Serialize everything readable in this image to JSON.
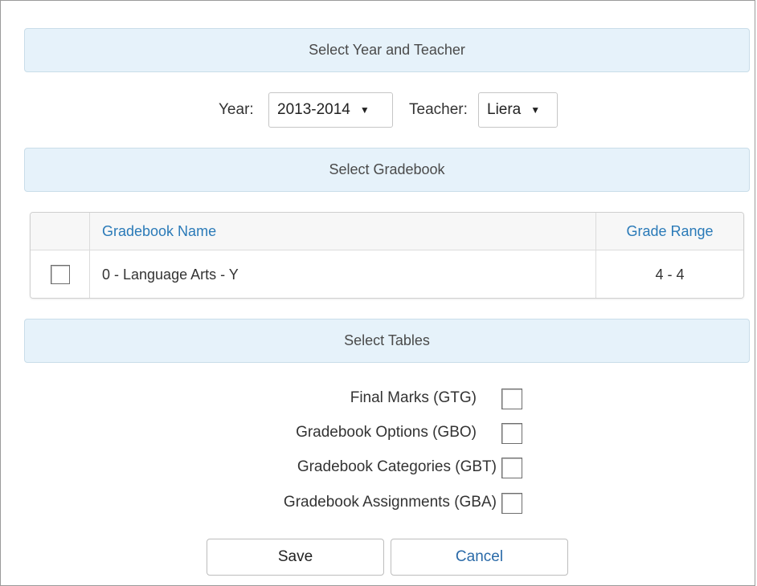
{
  "year_teacher": {
    "header": "Select Year and Teacher",
    "year_label": "Year:",
    "year_value": "2013-2014",
    "teacher_label": "Teacher:",
    "teacher_value": "Liera"
  },
  "gradebook": {
    "header": "Select Gradebook",
    "columns": [
      "",
      "Gradebook Name",
      "Grade Range"
    ],
    "rows": [
      {
        "checked": false,
        "name": "0 - Language Arts - Y",
        "grade_range": "4 - 4"
      }
    ]
  },
  "tables": {
    "header": "Select Tables",
    "options": [
      {
        "label": "Final Marks (GTG)",
        "checked": false
      },
      {
        "label": "Gradebook Options (GBO)",
        "checked": false
      },
      {
        "label": "Gradebook Categories (GBT)",
        "checked": false
      },
      {
        "label": "Gradebook Assignments (GBA)",
        "checked": false
      }
    ]
  },
  "actions": {
    "save_label": "Save",
    "cancel_label": "Cancel"
  },
  "icons": {
    "dropdown": "caret-down-icon"
  },
  "colors": {
    "panel_bg": "#e6f2fa",
    "link": "#2a7ab8",
    "cancel_text": "#2a6aa8"
  }
}
